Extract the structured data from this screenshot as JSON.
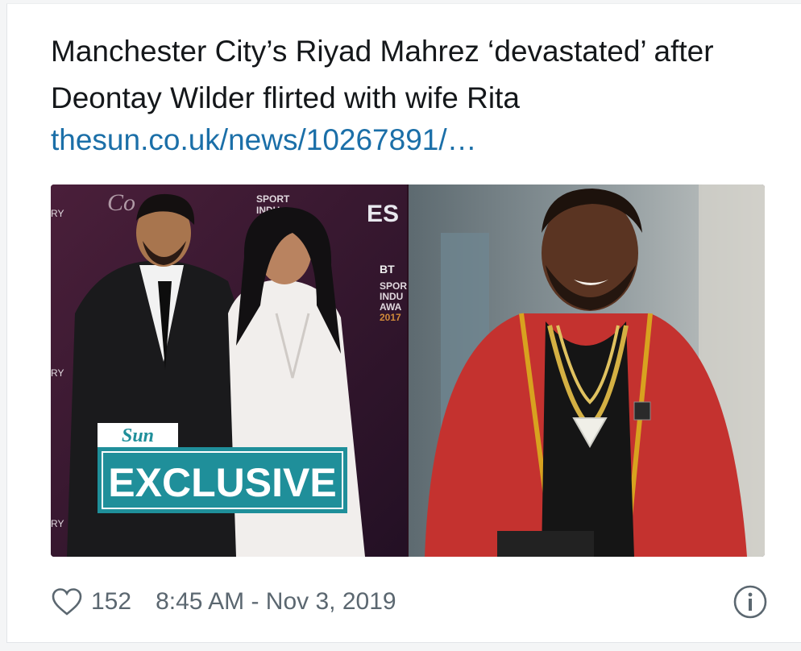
{
  "tweet": {
    "title": "Manchester City’s Riyad Mahrez ‘devastated’ after Deontay Wilder flirted with wife Rita",
    "link": "thesun.co.uk/news/10267891/…"
  },
  "media": {
    "badge_brand": "Sun",
    "badge_label": "EXCLUSIVE",
    "backdrop_text_1": "SPORT INDUSTRY AWARDS",
    "backdrop_text_2": "BT SPORT INDUSTRY AWARDS 2017",
    "logo_text": "BT"
  },
  "footer": {
    "like_count": "152",
    "timestamp": "8:45 AM - Nov 3, 2019"
  },
  "icons": {
    "like": "heart-outline-icon",
    "info": "info-circle-icon"
  },
  "colors": {
    "link": "#1b6fa8",
    "badge": "#1f8f9a",
    "text": "#14171a",
    "meta": "#5b6770"
  }
}
